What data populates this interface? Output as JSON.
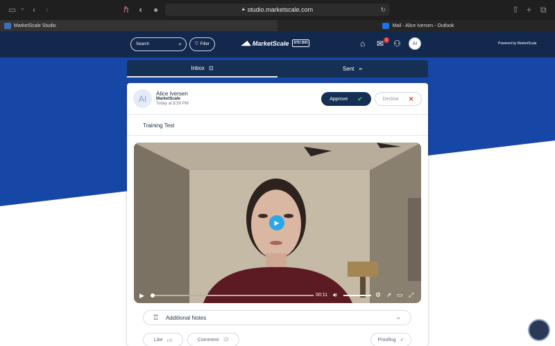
{
  "browser": {
    "url": "studio.marketscale.com",
    "tabs": [
      {
        "label": "MarketScale Studio",
        "active": true,
        "favicon_color": "#3b6fb6"
      },
      {
        "label": "Mail - Alice Iversen - Outlook",
        "active": false,
        "favicon_color": "#1a73e8"
      }
    ]
  },
  "header": {
    "search_placeholder": "Search",
    "filter_label": "Filter",
    "logo_text": "MarketScale",
    "logo_badge": "STU DIO",
    "notification_count": "1",
    "user_initials": "AI",
    "powered_by": "Powered by MarketScale"
  },
  "segments": {
    "inbox_label": "Inbox",
    "sent_label": "Sent"
  },
  "message": {
    "sender_initials": "AI",
    "sender_name": "Alice Iversen",
    "sender_org": "MarketScale",
    "timestamp": "Today at 8:59 PM",
    "approve_label": "Approve",
    "decline_label": "Decline",
    "subject": "Training Test"
  },
  "video": {
    "current_time": "00:11",
    "progress": 0.0
  },
  "notes": {
    "label": "Additional Notes"
  },
  "actions": {
    "like_label": "Like",
    "comment_label": "Comment",
    "proofing_label": "Proofing"
  },
  "colors": {
    "header_navy": "#13284d",
    "brand_blue": "#1747a6",
    "approve_bg": "#162f55",
    "play_blue": "#2aa7e8",
    "decline_x": "#d84040"
  }
}
